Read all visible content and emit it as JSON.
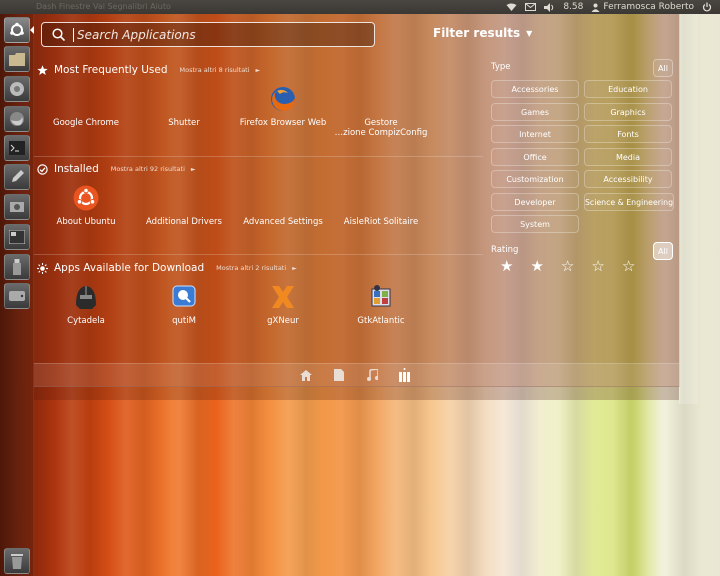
{
  "top_panel": {
    "ghost_text": "Dash   Finestre   Vai   Segnalibri   Aiuto",
    "time": "8.58",
    "user": "Ferramosca Roberto"
  },
  "launcher": {
    "items": [
      "dash-home",
      "files",
      "chrome",
      "firefox",
      "terminal",
      "text-editor",
      "system-settings",
      "workspaces",
      "usb-drive",
      "drive",
      "trash"
    ]
  },
  "search": {
    "placeholder": "Search Applications"
  },
  "filters": {
    "header": "Filter results",
    "type_label": "Type",
    "all_label": "All",
    "types": [
      "Accessories",
      "Education",
      "Games",
      "Graphics",
      "Internet",
      "Fonts",
      "Office",
      "Media",
      "Customization",
      "Accessibility",
      "Developer",
      "Science & Engineering",
      "System"
    ],
    "rating_label": "Rating",
    "rating_all_label": "All",
    "rating": {
      "filled": 2,
      "max": 5
    }
  },
  "sections": {
    "frequent": {
      "title": "Most Frequently Used",
      "more": "Mostra altri 8 risultati",
      "apps": [
        "Google Chrome",
        "Shutter",
        "Firefox Browser Web",
        "Gestore\n…zione CompizConfig"
      ]
    },
    "installed": {
      "title": "Installed",
      "more": "Mostra altri 92 risultati",
      "apps": [
        "About Ubuntu",
        "Additional Drivers",
        "Advanced Settings",
        "AisleRiot Solitaire"
      ]
    },
    "download": {
      "title": "Apps Available for Download",
      "more": "Mostra altri 2 risultati",
      "apps": [
        "Cytadela",
        "qutiM",
        "gXNeur",
        "GtkAtlantic"
      ]
    }
  },
  "lenses": [
    "home-lens",
    "files-lens",
    "music-lens",
    "apps-lens"
  ],
  "colors": {
    "accent": "#e95420",
    "dash_tint": "#782810"
  }
}
